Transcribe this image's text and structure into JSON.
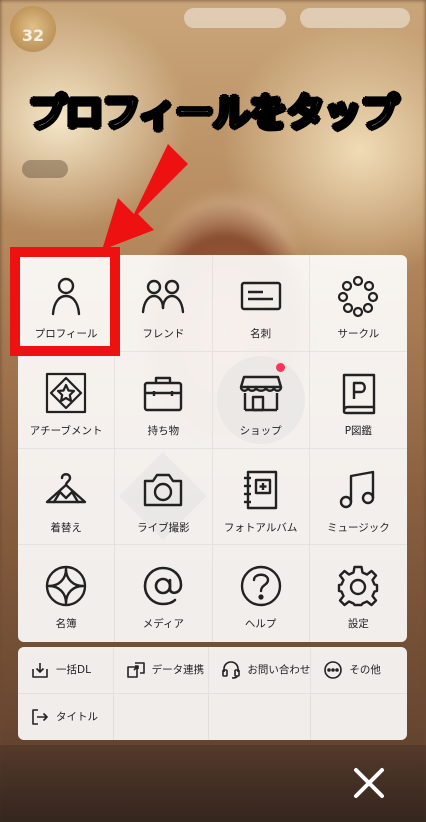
{
  "hud": {
    "level": "32"
  },
  "caption": "プロフィールをタップ",
  "menu": {
    "items": [
      {
        "label": "プロフィール",
        "icon": "person-icon"
      },
      {
        "label": "フレンド",
        "icon": "friends-icon"
      },
      {
        "label": "名刺",
        "icon": "business-card-icon"
      },
      {
        "label": "サークル",
        "icon": "circle-dots-icon"
      },
      {
        "label": "アチーブメント",
        "icon": "achievement-icon"
      },
      {
        "label": "持ち物",
        "icon": "bag-icon"
      },
      {
        "label": "ショップ",
        "icon": "shop-icon"
      },
      {
        "label": "P図鑑",
        "icon": "p-book-icon"
      },
      {
        "label": "着替え",
        "icon": "hanger-icon"
      },
      {
        "label": "ライブ撮影",
        "icon": "camera-icon"
      },
      {
        "label": "フォトアルバム",
        "icon": "photo-album-icon"
      },
      {
        "label": "ミュージック",
        "icon": "music-icon"
      },
      {
        "label": "名簿",
        "icon": "roster-icon"
      },
      {
        "label": "メディア",
        "icon": "at-sign-icon"
      },
      {
        "label": "ヘルプ",
        "icon": "help-icon"
      },
      {
        "label": "設定",
        "icon": "gear-icon"
      }
    ],
    "notification_color": "#ff3355",
    "highlight_color": "#ee1111"
  },
  "submenu": {
    "items": [
      {
        "label": "一括DL",
        "icon": "download-icon"
      },
      {
        "label": "データ連携",
        "icon": "data-link-icon"
      },
      {
        "label": "お問い合わせ",
        "icon": "headset-icon"
      },
      {
        "label": "その他",
        "icon": "more-icon"
      },
      {
        "label": "タイトル",
        "icon": "exit-icon"
      }
    ]
  }
}
